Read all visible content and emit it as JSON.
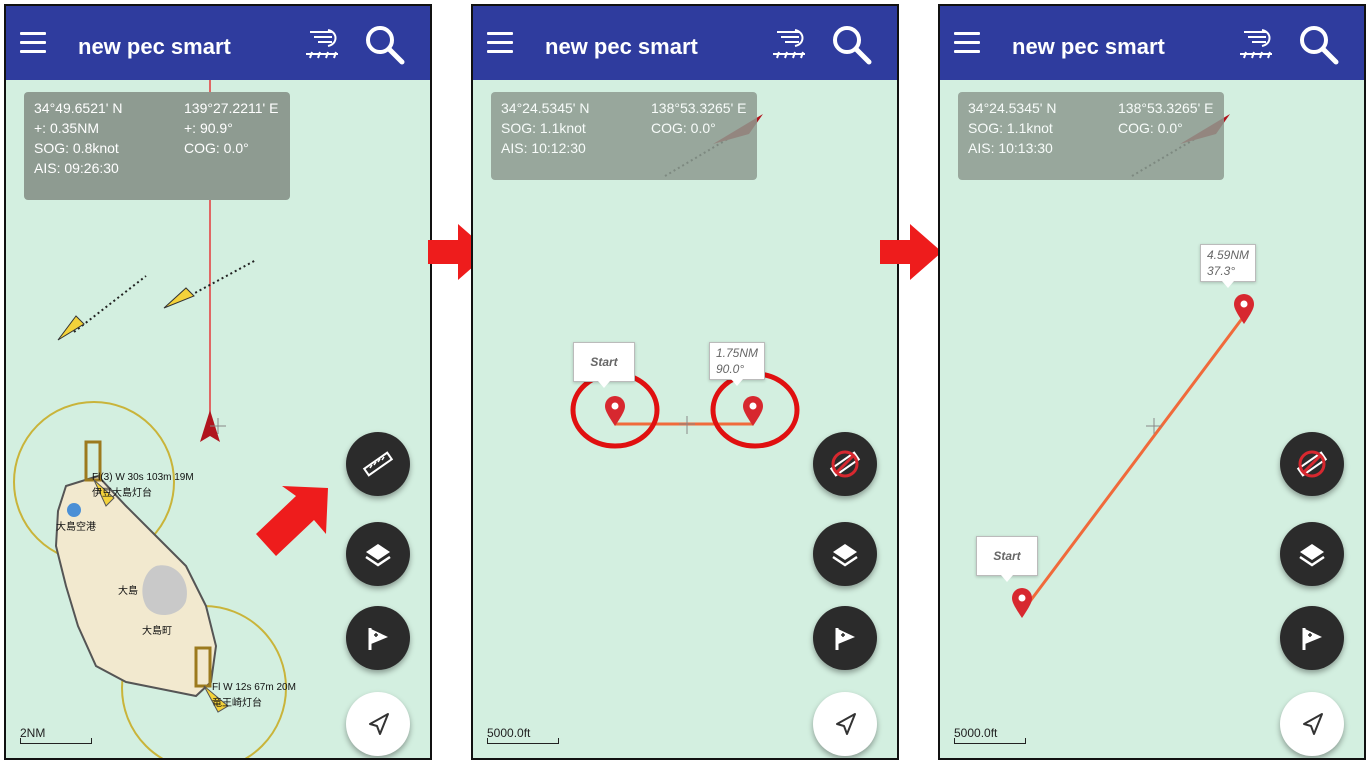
{
  "app": {
    "title": "new pec smart",
    "colors": {
      "appbar": "#2f3c9e",
      "map_water": "#d3efe0",
      "route": "#f06a3b",
      "pin": "#d7282f",
      "highlight_circle": "#e01010",
      "arrow": "#ee1c1c"
    }
  },
  "panel1": {
    "info": {
      "lat": "34°49.6521' N",
      "lon": "139°27.2211' E",
      "dist": "+: 0.35NM",
      "bearing": "+: 90.9°",
      "sog": "SOG: 0.8knot",
      "cog": "COG: 0.0°",
      "ais": "AIS: 09:26:30"
    },
    "labels": {
      "light1": "Fl(3) W 30s 103m 19M",
      "light1_name": "伊豆大島灯台",
      "airport": "大島空港",
      "island": "大島",
      "town": "大島町",
      "light2": "Fl W 12s 67m 20M",
      "light2_name": "竜王崎灯台"
    },
    "scale": "2NM"
  },
  "panel2": {
    "info": {
      "lat": "34°24.5345' N",
      "lon": "138°53.3265' E",
      "sog": "SOG: 1.1knot",
      "cog": "COG: 0.0°",
      "ais": "AIS: 10:12:30"
    },
    "start_label": "Start",
    "distance": "1.75NM",
    "bearing": "90.0°",
    "scale": "5000.0ft"
  },
  "panel3": {
    "info": {
      "lat": "34°24.5345' N",
      "lon": "138°53.3265' E",
      "sog": "SOG: 1.1knot",
      "cog": "COG: 0.0°",
      "ais": "AIS: 10:13:30"
    },
    "start_label": "Start",
    "distance": "4.59NM",
    "bearing": "37.3°",
    "scale": "5000.0ft"
  },
  "icons": {
    "menu": "menu-icon",
    "tide": "tide-icon",
    "search": "search-icon",
    "ruler": "ruler-icon",
    "ruler_off": "ruler-off-icon",
    "layers": "layers-icon",
    "flag": "flag-icon",
    "navigate": "navigate-icon"
  }
}
